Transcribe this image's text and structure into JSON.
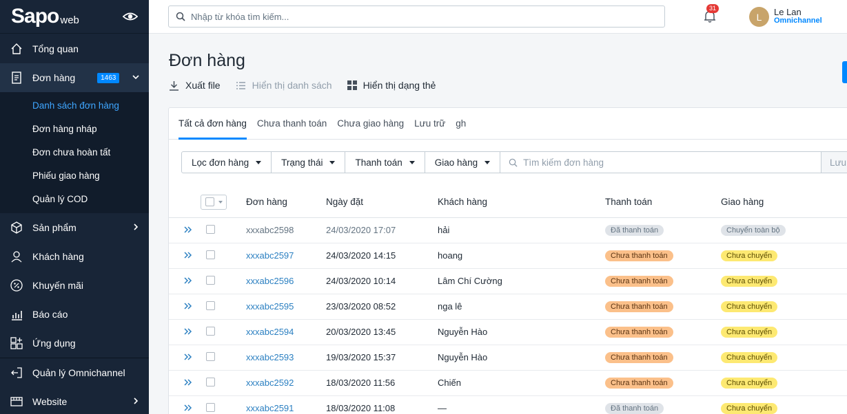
{
  "brand": {
    "logo": "Sapo",
    "suffix": "web"
  },
  "sidebar": {
    "items": [
      {
        "label": "Tổng quan",
        "icon": "home-icon"
      },
      {
        "label": "Đơn hàng",
        "icon": "order-icon",
        "badge": "1463"
      },
      {
        "label": "Sản phẩm",
        "icon": "box-icon"
      },
      {
        "label": "Khách hàng",
        "icon": "user-icon"
      },
      {
        "label": "Khuyến mãi",
        "icon": "percent-icon"
      },
      {
        "label": "Báo cáo",
        "icon": "chart-icon"
      },
      {
        "label": "Ứng dụng",
        "icon": "apps-icon"
      },
      {
        "label": "Quản lý Omnichannel",
        "icon": "login-icon"
      },
      {
        "label": "Website",
        "icon": "store-icon"
      }
    ],
    "orders_sub": [
      "Danh sách đơn hàng",
      "Đơn hàng nháp",
      "Đơn chưa hoàn tất",
      "Phiếu giao hàng",
      "Quản lý COD"
    ]
  },
  "topbar": {
    "search_placeholder": "Nhập từ khóa tìm kiếm...",
    "notification_count": "31",
    "user_initial": "L",
    "user_name": "Le Lan",
    "user_plan": "Omnichannel"
  },
  "page": {
    "title": "Đơn hàng",
    "actions": {
      "export": "Xuất file",
      "list_view": "Hiển thị danh sách",
      "card_view": "Hiển thị dạng thẻ"
    }
  },
  "tabs": [
    "Tất cả đơn hàng",
    "Chưa thanh toán",
    "Chưa giao hàng",
    "Lưu trữ",
    "gh"
  ],
  "filters": {
    "filter": "Lọc đơn hàng",
    "status": "Trạng thái",
    "payment": "Thanh toán",
    "shipping": "Giao hàng",
    "search_placeholder": "Tìm kiếm đơn hàng",
    "save": "Lưu bộ"
  },
  "table": {
    "headers": {
      "order": "Đơn hàng",
      "date": "Ngày đặt",
      "customer": "Khách hàng",
      "payment": "Thanh toán",
      "shipping": "Giao hàng"
    },
    "rows": [
      {
        "id": "xxxabc2598",
        "date": "24/03/2020 17:07",
        "customer": "hải",
        "payment": "Đã thanh toán",
        "shipping": "Chuyển toàn bộ"
      },
      {
        "id": "xxxabc2597",
        "date": "24/03/2020 14:15",
        "customer": "hoang",
        "payment": "Chưa thanh toán",
        "shipping": "Chưa chuyển"
      },
      {
        "id": "xxxabc2596",
        "date": "24/03/2020 10:14",
        "customer": "Lâm Chí Cường",
        "payment": "Chưa thanh toán",
        "shipping": "Chưa chuyển"
      },
      {
        "id": "xxxabc2595",
        "date": "23/03/2020 08:52",
        "customer": "nga lê",
        "payment": "Chưa thanh toán",
        "shipping": "Chưa chuyển"
      },
      {
        "id": "xxxabc2594",
        "date": "20/03/2020 13:45",
        "customer": "Nguyễn Hào",
        "payment": "Chưa thanh toán",
        "shipping": "Chưa chuyển"
      },
      {
        "id": "xxxabc2593",
        "date": "19/03/2020 15:37",
        "customer": "Nguyễn Hào",
        "payment": "Chưa thanh toán",
        "shipping": "Chưa chuyển"
      },
      {
        "id": "xxxabc2592",
        "date": "18/03/2020 11:56",
        "customer": "Chiến",
        "payment": "Chưa thanh toán",
        "shipping": "Chưa chuyển"
      },
      {
        "id": "xxxabc2591",
        "date": "18/03/2020 11:08",
        "customer": "—",
        "payment": "Đã thanh toán",
        "shipping": "Chưa chuyển"
      }
    ]
  }
}
